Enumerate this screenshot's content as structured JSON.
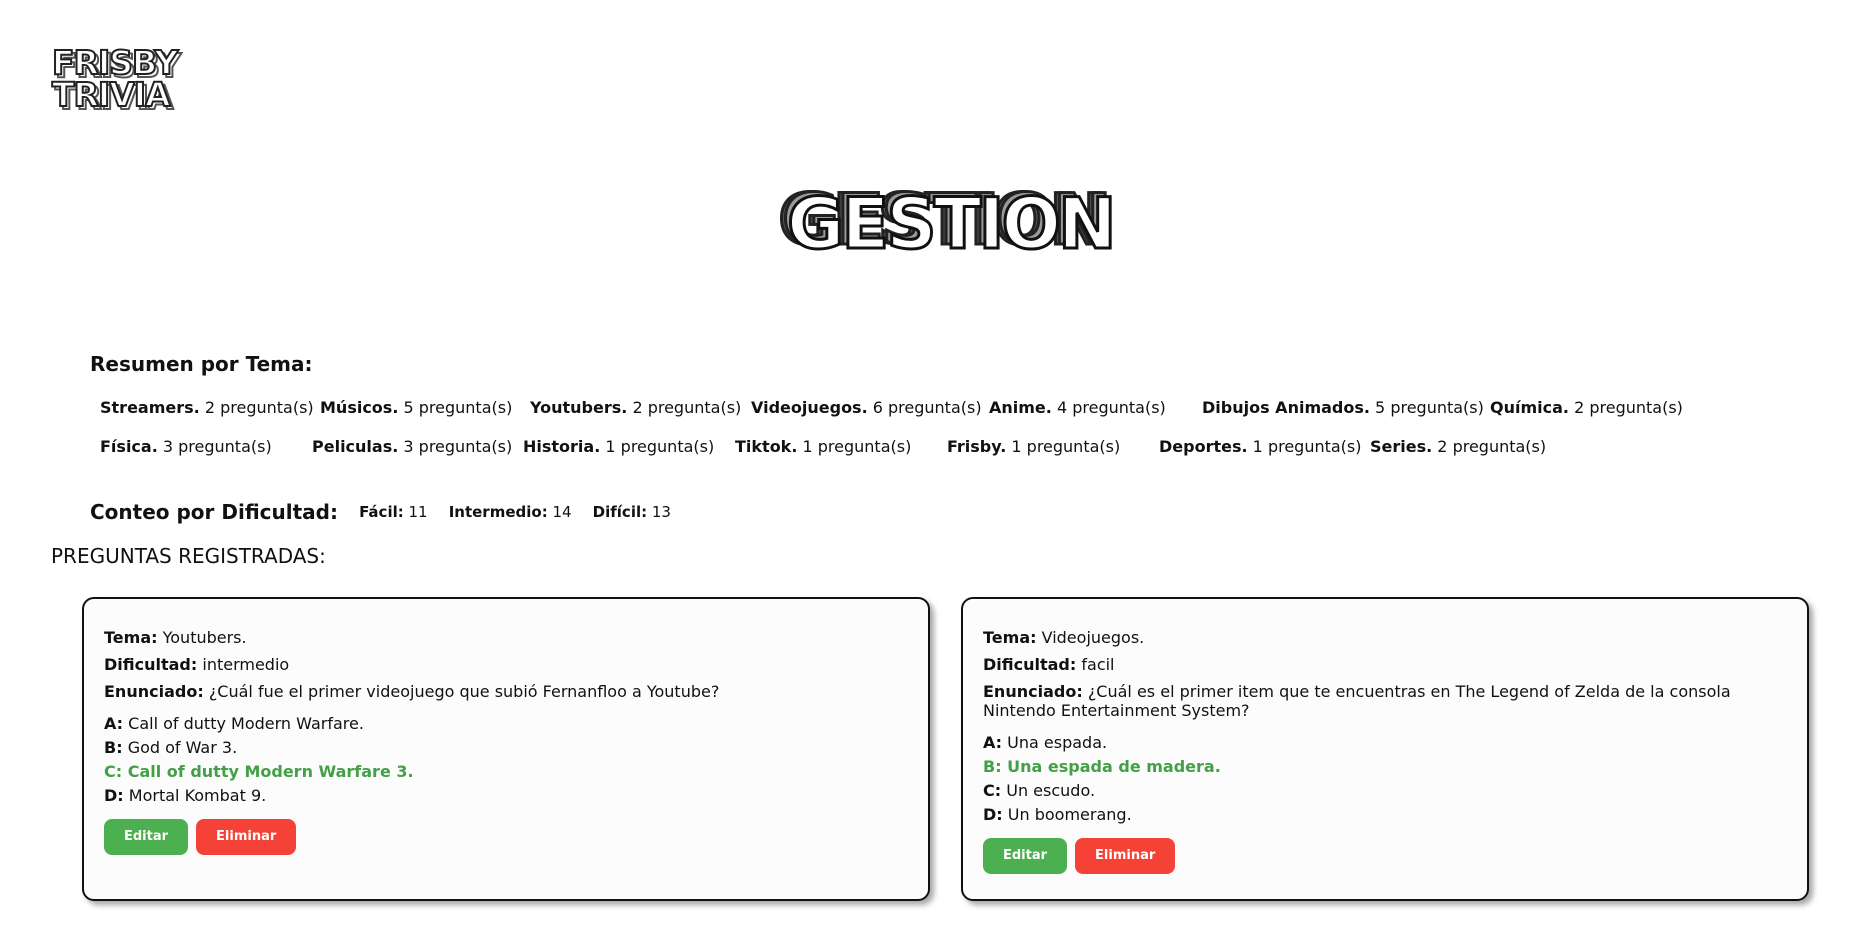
{
  "logo": {
    "line1": "FRISBY",
    "line2": "TRIVIA"
  },
  "page_title": "GESTION",
  "summary": {
    "heading": "Resumen por Tema:",
    "row1": [
      {
        "topic": "Streamers.",
        "count": "2 pregunta(s)"
      },
      {
        "topic": "Músicos.",
        "count": "5 pregunta(s)"
      },
      {
        "topic": "Youtubers.",
        "count": "2 pregunta(s)"
      },
      {
        "topic": "Videojuegos.",
        "count": "6 pregunta(s)"
      },
      {
        "topic": "Anime.",
        "count": "4 pregunta(s)"
      },
      {
        "topic": "Dibujos Animados.",
        "count": "5 pregunta(s)"
      },
      {
        "topic": "Química.",
        "count": "2 pregunta(s)"
      }
    ],
    "row2": [
      {
        "topic": "Física.",
        "count": "3 pregunta(s)"
      },
      {
        "topic": "Peliculas.",
        "count": "3 pregunta(s)"
      },
      {
        "topic": "Historia.",
        "count": "1 pregunta(s)"
      },
      {
        "topic": "Tiktok.",
        "count": "1 pregunta(s)"
      },
      {
        "topic": "Frisby.",
        "count": "1 pregunta(s)"
      },
      {
        "topic": "Deportes.",
        "count": "1 pregunta(s)"
      },
      {
        "topic": "Series.",
        "count": "2 pregunta(s)"
      }
    ]
  },
  "difficulty": {
    "heading": "Conteo por Dificultad:",
    "items": [
      {
        "label": "Fácil:",
        "value": "11"
      },
      {
        "label": "Intermedio:",
        "value": "14"
      },
      {
        "label": "Difícil:",
        "value": "13"
      }
    ]
  },
  "registered_heading": "PREGUNTAS REGISTRADAS:",
  "labels": {
    "tema": "Tema:",
    "dificultad": "Dificultad:",
    "enunciado": "Enunciado:"
  },
  "questions": [
    {
      "tema": "Youtubers.",
      "dificultad": "intermedio",
      "enunciado": "¿Cuál fue el primer videojuego que subió Fernanfloo a Youtube?",
      "options": [
        {
          "letter": "A:",
          "text": "Call of dutty Modern Warfare."
        },
        {
          "letter": "B:",
          "text": "God of War 3."
        },
        {
          "letter": "C:",
          "text": "Call of dutty Modern Warfare 3."
        },
        {
          "letter": "D:",
          "text": "Mortal Kombat 9."
        }
      ],
      "correct": "C",
      "edit_label": "Editar",
      "delete_label": "Eliminar"
    },
    {
      "tema": "Videojuegos.",
      "dificultad": "facil",
      "enunciado": "¿Cuál es el primer item que te encuentras en The Legend of Zelda de la consola Nintendo Entertainment System?",
      "options": [
        {
          "letter": "A:",
          "text": "Una espada."
        },
        {
          "letter": "B:",
          "text": "Una espada de madera."
        },
        {
          "letter": "C:",
          "text": "Un escudo."
        },
        {
          "letter": "D:",
          "text": "Un boomerang."
        }
      ],
      "correct": "B",
      "edit_label": "Editar",
      "delete_label": "Eliminar"
    }
  ],
  "colors": {
    "correct": "#43a047",
    "edit": "#4caf50",
    "delete": "#f44336"
  }
}
